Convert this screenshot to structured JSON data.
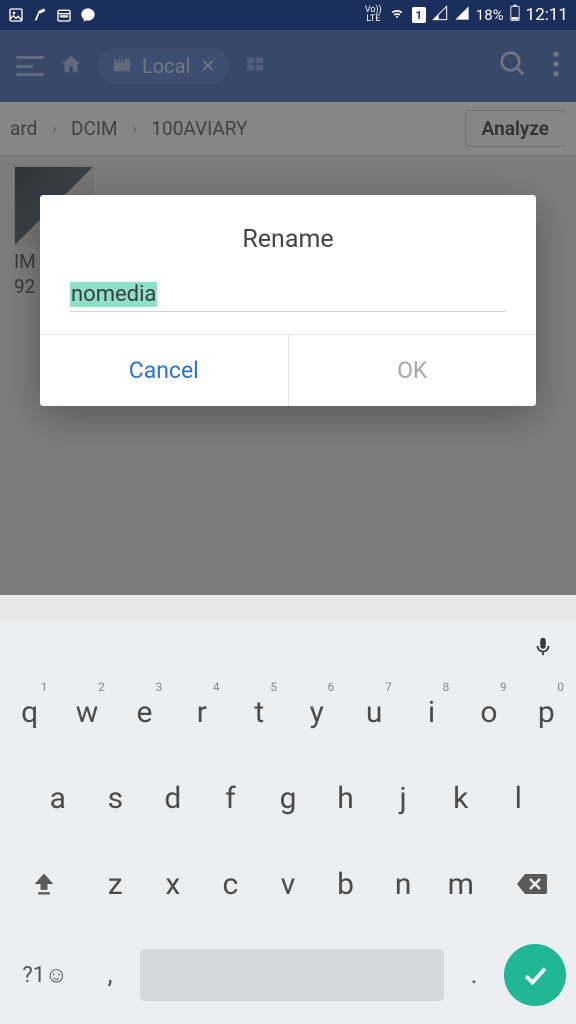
{
  "status": {
    "battery": "18%",
    "time": "12:11",
    "lte": "LTE",
    "sim": "1"
  },
  "appbar": {
    "tab_label": "Local"
  },
  "breadcrumb": {
    "seg0": "ard",
    "seg1": "DCIM",
    "seg2": "100AVIARY",
    "analyze": "Analyze"
  },
  "grid": {
    "item0_l1": "IM",
    "item0_l2": "92"
  },
  "dialog": {
    "title": "Rename",
    "input_value": "nomedia",
    "cancel": "Cancel",
    "ok": "OK"
  },
  "keyboard": {
    "row1": [
      "q",
      "w",
      "e",
      "r",
      "t",
      "y",
      "u",
      "i",
      "o",
      "p"
    ],
    "nums": [
      "1",
      "2",
      "3",
      "4",
      "5",
      "6",
      "7",
      "8",
      "9",
      "0"
    ],
    "row2": [
      "a",
      "s",
      "d",
      "f",
      "g",
      "h",
      "j",
      "k",
      "l"
    ],
    "row3": [
      "z",
      "x",
      "c",
      "v",
      "b",
      "n",
      "m"
    ],
    "sym": "?1☺",
    "comma": ",",
    "dot": "."
  }
}
